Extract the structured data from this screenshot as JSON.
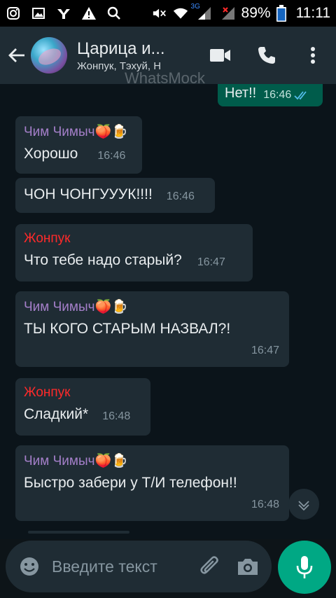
{
  "status_bar": {
    "network": "3G",
    "battery": "89%",
    "time": "11:11"
  },
  "header": {
    "title": "Царица и...",
    "subtitle": "Жонпук, Тэхуй, Н"
  },
  "watermark": "WhatsMock",
  "messages": [
    {
      "sender": "",
      "text": "Нет!!",
      "time": "16:46",
      "outgoing": true
    },
    {
      "sender": "Чим Чимыч🍑🍺",
      "text": "Хорошо",
      "time": "16:46"
    },
    {
      "sender": "",
      "text": "ЧОН ЧОНГУУУК!!!!",
      "time": "16:46"
    },
    {
      "sender": "Жонпук",
      "text": "Что тебе надо старый?",
      "time": "16:47"
    },
    {
      "sender": "Чим Чимыч🍑🍺",
      "text": "ТЫ КОГО СТАРЫМ НАЗВАЛ?!",
      "time": "16:47"
    },
    {
      "sender": "Жонпук",
      "text": "Сладкий*",
      "time": "16:48"
    },
    {
      "sender": "Чим Чимыч🍑🍺",
      "text": "Быстро забери у Т/И телефон!!",
      "time": "16:48"
    }
  ],
  "input": {
    "placeholder": "Введите текст"
  },
  "colors": {
    "header_bg": "#1f2c34",
    "chat_bg": "#0b141a",
    "incoming_bubble": "#1f2c34",
    "outgoing_bubble": "#005c4b",
    "accent": "#00a884",
    "sender_purple": "#a47fc9",
    "sender_red": "#ff2a2a",
    "read_ticks": "#53bdeb"
  },
  "icons": {
    "status_left": [
      "instagram-icon",
      "gallery-icon",
      "vk-icon",
      "warning-icon",
      "search-icon"
    ],
    "status_right": [
      "mute-icon",
      "wifi-icon",
      "signal-3g-icon",
      "signal-off-icon",
      "battery-icon"
    ],
    "header": [
      "back-arrow-icon",
      "video-call-icon",
      "phone-icon",
      "more-vert-icon"
    ],
    "input": [
      "emoji-icon",
      "attach-icon",
      "camera-icon",
      "mic-icon"
    ],
    "chat": [
      "chevron-down-icon",
      "double-check-icon"
    ]
  }
}
